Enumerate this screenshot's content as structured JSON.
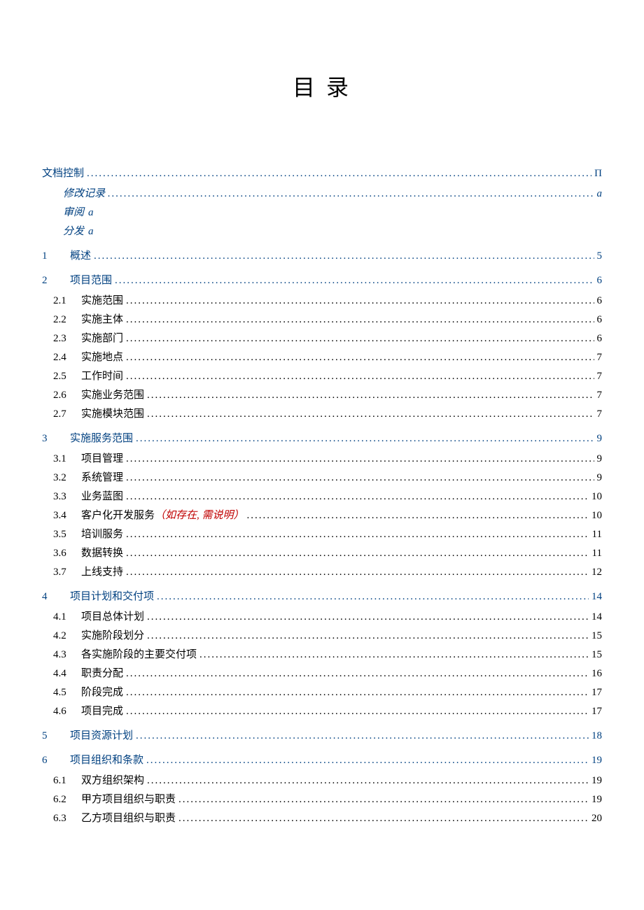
{
  "title": "目 录",
  "toc": [
    {
      "level": "l1",
      "label": "文档控制",
      "page": "Π"
    },
    {
      "level": "li",
      "label": "修改记录",
      "page": "a"
    },
    {
      "level": "li-noline",
      "label": "审阅",
      "page": "a"
    },
    {
      "level": "li-noline",
      "label": "分发",
      "page": "a"
    },
    {
      "level": "l1",
      "num": "1",
      "label": "概述",
      "page": "5"
    },
    {
      "level": "l1",
      "num": "2",
      "label": "项目范围",
      "page": "6"
    },
    {
      "level": "l2",
      "num": "2.1",
      "label": "实施范围",
      "page": "6"
    },
    {
      "level": "l2",
      "num": "2.2",
      "label": "实施主体",
      "page": "6"
    },
    {
      "level": "l2",
      "num": "2.3",
      "label": "实施部门",
      "page": "6"
    },
    {
      "level": "l2",
      "num": "2.4",
      "label": "实施地点",
      "page": "7"
    },
    {
      "level": "l2",
      "num": "2.5",
      "label": "工作时间",
      "page": "7"
    },
    {
      "level": "l2",
      "num": "2.6",
      "label": "实施业务范围",
      "page": "7"
    },
    {
      "level": "l2",
      "num": "2.7",
      "label": "实施模块范围",
      "page": "7"
    },
    {
      "level": "l1",
      "num": "3",
      "label": "实施服务范围",
      "page": "9"
    },
    {
      "level": "l2",
      "num": "3.1",
      "label": "项目管理",
      "page": "9"
    },
    {
      "level": "l2",
      "num": "3.2",
      "label": "系统管理",
      "page": "9"
    },
    {
      "level": "l2",
      "num": "3.3",
      "label": "业务蓝图",
      "page": "10"
    },
    {
      "level": "l2",
      "num": "3.4",
      "label": "客户化开发服务",
      "annot": "（如存在, 需说明）",
      "page": "10"
    },
    {
      "level": "l2",
      "num": "3.5",
      "label": "培训服务",
      "page": "11"
    },
    {
      "level": "l2",
      "num": "3.6",
      "label": "数据转换",
      "page": "11"
    },
    {
      "level": "l2",
      "num": "3.7",
      "label": "上线支持",
      "page": "12"
    },
    {
      "level": "l1",
      "num": "4",
      "label": "项目计划和交付项",
      "page": "14"
    },
    {
      "level": "l2",
      "num": "4.1",
      "label": "项目总体计划",
      "page": "14"
    },
    {
      "level": "l2",
      "num": "4.2",
      "label": "实施阶段划分",
      "page": "15"
    },
    {
      "level": "l2",
      "num": "4.3",
      "label": "各实施阶段的主要交付项",
      "page": "15"
    },
    {
      "level": "l2",
      "num": "4.4",
      "label": "职责分配",
      "page": "16"
    },
    {
      "level": "l2",
      "num": "4.5",
      "label": "阶段完成",
      "page": "17"
    },
    {
      "level": "l2",
      "num": "4.6",
      "label": "项目完成",
      "page": "17"
    },
    {
      "level": "l1",
      "num": "5",
      "label": "项目资源计划",
      "page": "18"
    },
    {
      "level": "l1",
      "num": "6",
      "label": "项目组织和条款",
      "page": "19"
    },
    {
      "level": "l2",
      "num": "6.1",
      "label": "双方组织架构",
      "page": "19"
    },
    {
      "level": "l2",
      "num": "6.2",
      "label": "甲方项目组织与职责",
      "page": "19"
    },
    {
      "level": "l2",
      "num": "6.3",
      "label": "乙方项目组织与职责",
      "page": "20"
    }
  ]
}
